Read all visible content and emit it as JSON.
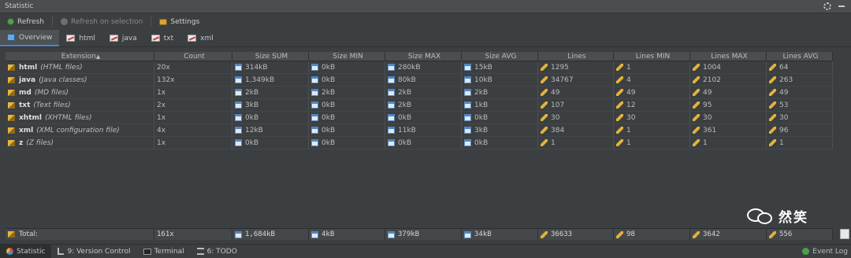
{
  "window": {
    "title": "Statistic"
  },
  "toolbar": {
    "refresh": "Refresh",
    "refresh_selection": "Refresh on selection",
    "settings": "Settings"
  },
  "tabs": [
    {
      "label": "Overview",
      "icon": "overview-icon",
      "active": true
    },
    {
      "label": "html",
      "icon": "chart-icon"
    },
    {
      "label": "java",
      "icon": "chart-icon"
    },
    {
      "label": "txt",
      "icon": "chart-icon"
    },
    {
      "label": "xml",
      "icon": "chart-icon"
    }
  ],
  "table": {
    "headers": [
      "Extension",
      "Count",
      "Size SUM",
      "Size MIN",
      "Size MAX",
      "Size AVG",
      "Lines",
      "Lines MIN",
      "Lines MAX",
      "Lines AVG"
    ],
    "sort_column": "Extension",
    "sort_direction": "ascending",
    "rows": [
      {
        "ext": "html",
        "desc": "(HTML files)",
        "count": "20x",
        "size_sum": "314kB",
        "size_min": "0kB",
        "size_max": "280kB",
        "size_avg": "15kB",
        "lines": "1295",
        "lines_min": "1",
        "lines_max": "1004",
        "lines_avg": "64"
      },
      {
        "ext": "java",
        "desc": "(Java classes)",
        "count": "132x",
        "size_sum": "1,349kB",
        "size_min": "0kB",
        "size_max": "80kB",
        "size_avg": "10kB",
        "lines": "34767",
        "lines_min": "4",
        "lines_max": "2102",
        "lines_avg": "263"
      },
      {
        "ext": "md",
        "desc": "(MD files)",
        "count": "1x",
        "size_sum": "2kB",
        "size_min": "2kB",
        "size_max": "2kB",
        "size_avg": "2kB",
        "lines": "49",
        "lines_min": "49",
        "lines_max": "49",
        "lines_avg": "49"
      },
      {
        "ext": "txt",
        "desc": "(Text files)",
        "count": "2x",
        "size_sum": "3kB",
        "size_min": "0kB",
        "size_max": "2kB",
        "size_avg": "1kB",
        "lines": "107",
        "lines_min": "12",
        "lines_max": "95",
        "lines_avg": "53"
      },
      {
        "ext": "xhtml",
        "desc": "(XHTML files)",
        "count": "1x",
        "size_sum": "0kB",
        "size_min": "0kB",
        "size_max": "0kB",
        "size_avg": "0kB",
        "lines": "30",
        "lines_min": "30",
        "lines_max": "30",
        "lines_avg": "30"
      },
      {
        "ext": "xml",
        "desc": "(XML configuration file)",
        "count": "4x",
        "size_sum": "12kB",
        "size_min": "0kB",
        "size_max": "11kB",
        "size_avg": "3kB",
        "lines": "384",
        "lines_min": "1",
        "lines_max": "361",
        "lines_avg": "96"
      },
      {
        "ext": "z",
        "desc": "(Z files)",
        "count": "1x",
        "size_sum": "0kB",
        "size_min": "0kB",
        "size_max": "0kB",
        "size_avg": "0kB",
        "lines": "1",
        "lines_min": "1",
        "lines_max": "1",
        "lines_avg": "1"
      }
    ],
    "total": {
      "label": "Total:",
      "count": "161x",
      "size_sum": "1,684kB",
      "size_min": "4kB",
      "size_max": "379kB",
      "size_avg": "34kB",
      "lines": "36633",
      "lines_min": "98",
      "lines_max": "3642",
      "lines_avg": "556"
    }
  },
  "watermark": {
    "text": "然笑"
  },
  "statusbar": {
    "items": [
      {
        "label": "Statistic",
        "icon": "statistic-icon",
        "active": true
      },
      {
        "label": "9: Version Control",
        "icon": "version-control-icon"
      },
      {
        "label": "Terminal",
        "icon": "terminal-icon"
      },
      {
        "label": "6: TODO",
        "icon": "todo-icon"
      }
    ],
    "event_log": "Event Log"
  },
  "colors": {
    "background": "#3c3f41",
    "active_tab_underline": "#4a88c7",
    "refresh_icon": "#53a04f",
    "file_icon": "#e8b53c"
  }
}
